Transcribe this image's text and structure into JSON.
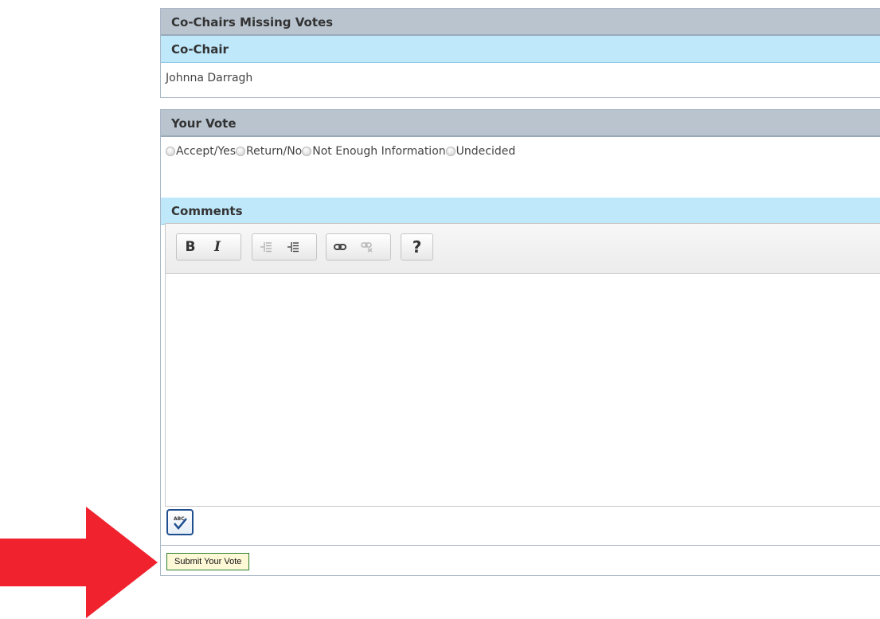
{
  "missing_votes": {
    "title": "Co-Chairs Missing Votes",
    "column_header": "Co-Chair",
    "rows": [
      "Johnna Darragh"
    ]
  },
  "vote": {
    "title": "Your Vote",
    "options": [
      "Accept/Yes",
      "Return/No",
      "Not Enough Information",
      "Undecided"
    ],
    "comments_title": "Comments"
  },
  "editor": {
    "toolbar": {
      "bold": "B",
      "italic": "I",
      "help": "?",
      "icons": [
        "bold-icon",
        "italic-icon",
        "outdent-icon",
        "indent-icon",
        "link-icon",
        "unlink-icon",
        "help-icon"
      ]
    },
    "spellcheck_icon": "spellcheck-icon"
  },
  "submit": {
    "label": "Submit Your Vote"
  },
  "colors": {
    "header_gray": "#b9c4cf",
    "header_blue": "#bfe8fb",
    "arrow_red": "#f0222e",
    "submit_bg": "#fdf9d6",
    "submit_border": "#2f7f2f"
  }
}
